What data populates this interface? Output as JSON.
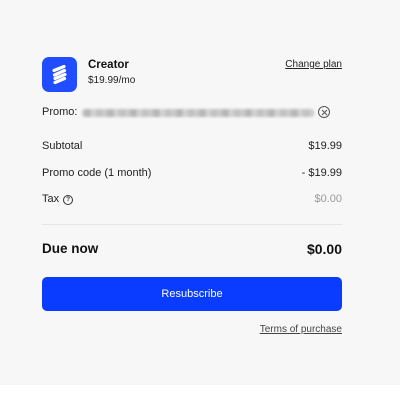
{
  "plan": {
    "name": "Creator",
    "price": "$19.99/mo",
    "change_label": "Change plan"
  },
  "promo": {
    "label": "Promo:"
  },
  "summary": {
    "lines": [
      {
        "label": "Subtotal",
        "value": "$19.99"
      },
      {
        "label": "Promo code (1 month)",
        "value": "- $19.99"
      },
      {
        "label": "Tax",
        "value": "$0.00"
      }
    ],
    "due_label": "Due now",
    "due_value": "$0.00"
  },
  "actions": {
    "resubscribe_label": "Resubscribe",
    "terms_label": "Terms of purchase"
  },
  "colors": {
    "brand": "#1f4dff",
    "button": "#0a3cff"
  }
}
